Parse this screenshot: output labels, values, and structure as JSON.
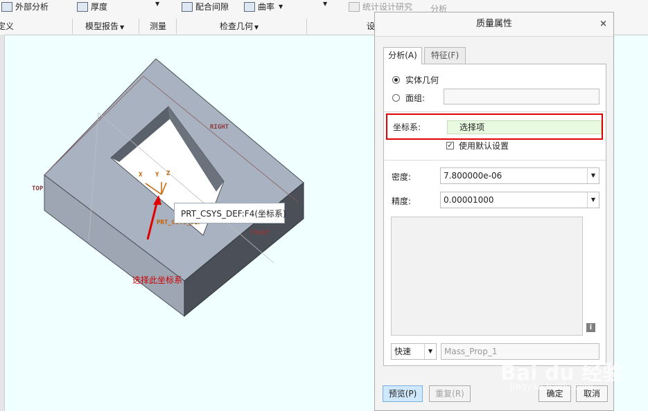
{
  "ribbon": {
    "row1": {
      "external_analysis": "外部分析",
      "thickness": "厚度",
      "clearance": "配合间隙",
      "curvature": "曲率",
      "statistical_design": "统计设计研究",
      "analysis": "分析"
    },
    "row2": {
      "definition": "定义",
      "model_report": "模型报告",
      "measure": "测量",
      "inspect_geometry": "检查几何",
      "design": "设"
    }
  },
  "viewport": {
    "tooltip": "PRT_CSYS_DEF:F4(坐标系)",
    "annotation": "选择此坐标系",
    "datum_right": "RIGHT",
    "datum_top": "TOP",
    "datum_front": "FRONT",
    "csys_label": "PRT_CSYS_DEF",
    "axis_x": "X",
    "axis_y": "Y",
    "axis_z": "Z"
  },
  "dialog": {
    "title": "质量属性",
    "close_glyph": "×",
    "tabs": [
      {
        "label": "分析(A)",
        "active": true
      },
      {
        "label": "特征(F)",
        "active": false
      }
    ],
    "options": {
      "solid_geometry": "实体几何",
      "quilt": "面组:",
      "selected": "solid_geometry"
    },
    "coord_system": {
      "label": "坐标系:",
      "value": "选择项",
      "use_default": "使用默认设置",
      "use_default_checked": true
    },
    "density": {
      "label": "密度:",
      "value": "7.800000e-06"
    },
    "accuracy": {
      "label": "精度:",
      "value": "0.00001000"
    },
    "info_icon": "i",
    "mode": {
      "value": "快速"
    },
    "name_placeholder": "Mass_Prop_1",
    "buttons": {
      "preview": "预览(P)",
      "repeat": "重复(R)",
      "ok": "确定",
      "cancel": "取消"
    }
  },
  "watermark": {
    "main": "Bai du 经验",
    "sub": "jingyan.baidu.com"
  },
  "colors": {
    "highlight": "#e00000",
    "annotation": "#d00000",
    "primary_button": "#cfe8fb",
    "background": "#f0ffff"
  }
}
